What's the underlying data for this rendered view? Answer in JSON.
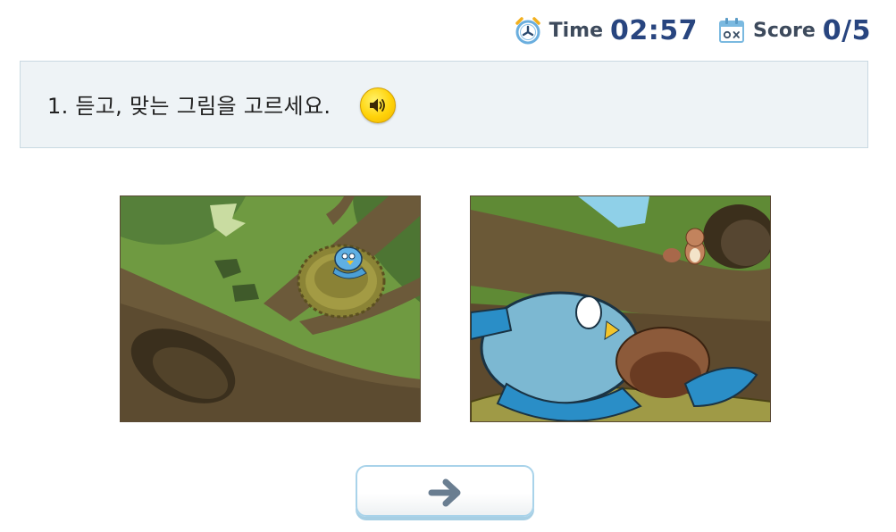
{
  "header": {
    "time": {
      "label": "Time",
      "value": "02:57",
      "icon": "clock-icon"
    },
    "score": {
      "label": "Score",
      "value": "0/5",
      "icon": "calendar-ox-icon"
    }
  },
  "question": {
    "text": "1. 듣고, 맞는 그림을 고르세요.",
    "sound_icon": "speaker-icon"
  },
  "choices": [
    {
      "id": 1,
      "scene": "bird-in-nest-on-tree-branch"
    },
    {
      "id": 2,
      "scene": "bird-in-nest-with-squirrel-closeup"
    }
  ],
  "next_button": {
    "icon": "arrow-right-icon"
  },
  "colors": {
    "score_value": "#28457f",
    "panel_bg": "#eef3f6",
    "sound_button": "#ffd30a",
    "next_border": "#a9d3ea",
    "arrow": "#6a7e91"
  }
}
